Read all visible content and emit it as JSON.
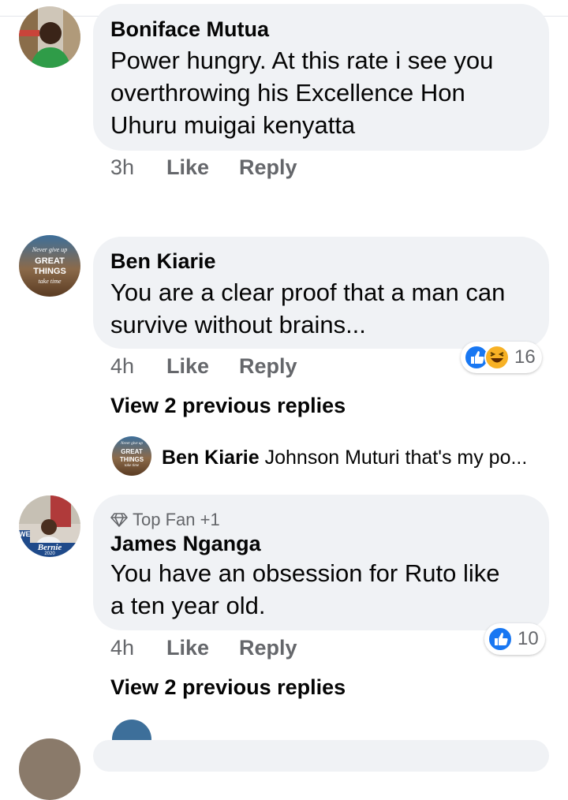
{
  "comments": [
    {
      "author": "Boniface Mutua",
      "lines": [
        "Power hungry. At this rate i see you",
        "overthrowing his Excellence Hon",
        "Uhuru muigai kenyatta"
      ],
      "time": "3h",
      "like_label": "Like",
      "reply_label": "Reply"
    },
    {
      "author": "Ben Kiarie",
      "avatar_text": {
        "top": "Never give up",
        "mid1": "GREAT",
        "mid2": "THINGS",
        "bot": "take time"
      },
      "lines": [
        "You are a clear proof that a man can",
        "survive without brains..."
      ],
      "time": "4h",
      "like_label": "Like",
      "reply_label": "Reply",
      "reactions": {
        "icons": [
          "like-reaction-icon",
          "haha-reaction-icon"
        ],
        "count": "16"
      },
      "view_replies": "View 2 previous replies",
      "latest_reply": {
        "author": "Ben Kiarie",
        "text": "Johnson Muturi that's my po..."
      }
    },
    {
      "badge": "Top Fan +1",
      "author": "James Nganga",
      "avatar_text": {
        "sign": "Bernie",
        "left": "WE",
        "year": "2020"
      },
      "lines": [
        "You have an obsession for Ruto like",
        "a ten year old."
      ],
      "time": "4h",
      "like_label": "Like",
      "reply_label": "Reply",
      "reactions": {
        "icons": [
          "like-reaction-icon"
        ],
        "count": "10"
      },
      "view_replies": "View 2 previous replies"
    }
  ],
  "colors": {
    "bubble": "#f0f2f5",
    "meta": "#65676b",
    "like_blue": "#1877f2",
    "haha_yellow": "#f7b125"
  }
}
